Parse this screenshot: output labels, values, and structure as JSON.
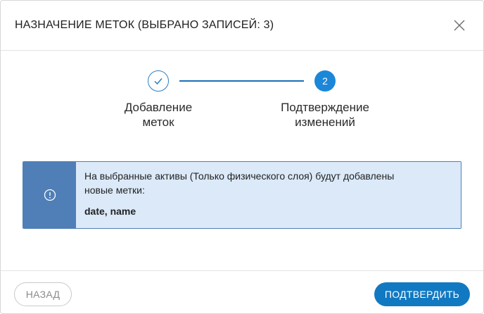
{
  "dialog": {
    "title": "НАЗНАЧЕНИЕ МЕТОК (ВЫБРАНО ЗАПИСЕЙ: 3)",
    "close_icon": "close-icon"
  },
  "wizard": {
    "steps": [
      {
        "label_line1": "Добавление",
        "label_line2": "меток",
        "status": "completed",
        "icon": "check-icon"
      },
      {
        "number": "2",
        "label_line1": "Подтверждение",
        "label_line2": "изменений",
        "status": "active"
      }
    ]
  },
  "info": {
    "icon": "info-icon",
    "message_line1": "На выбранные активы (Только физического слоя) будут добавлены",
    "message_line2": "новые метки:",
    "tags": "date, name"
  },
  "footer": {
    "back_label": "НАЗАД",
    "confirm_label": "ПОДТВЕРДИТЬ"
  },
  "colors": {
    "accent": "#1c87d8",
    "info_bg": "#dbe9f9",
    "info_side": "#4f7fb6"
  }
}
